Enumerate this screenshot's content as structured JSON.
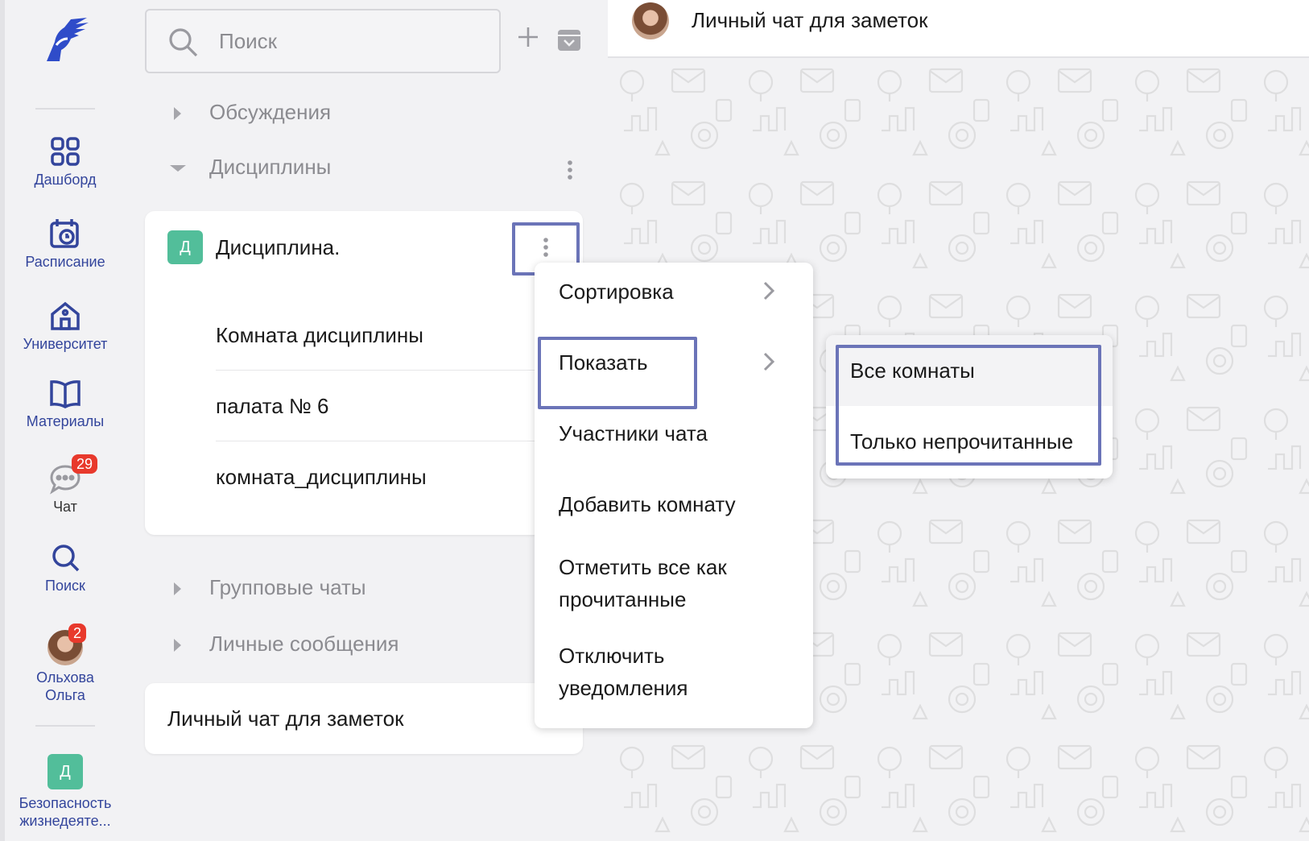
{
  "nav": {
    "items": [
      {
        "label": "Дашборд",
        "icon": "grid-icon"
      },
      {
        "label": "Расписание",
        "icon": "calendar-clock-icon"
      },
      {
        "label": "Университет",
        "icon": "university-icon"
      },
      {
        "label": "Материалы",
        "icon": "book-icon"
      },
      {
        "label": "Чат",
        "icon": "chat-bubble-icon",
        "badge": "29"
      },
      {
        "label": "Поиск",
        "icon": "search-icon"
      }
    ],
    "user": {
      "name_line1": "Ольхова",
      "name_line2": "Ольга",
      "badge": "2"
    },
    "org": {
      "tile": "Д",
      "label_line1": "Безопасность",
      "label_line2": "жизнедеяте..."
    }
  },
  "search": {
    "placeholder": "Поиск"
  },
  "sections": {
    "discussions": "Обсуждения",
    "disciplines": "Дисциплины",
    "group_chats": "Групповые чаты",
    "personal": "Личные сообщения"
  },
  "discipline": {
    "tile": "Д",
    "name": "Дисциплина.",
    "rooms": [
      "Комната дисциплины",
      "палата № 6",
      "комната_дисциплины"
    ]
  },
  "note_chat": "Личный чат для заметок",
  "chat": {
    "title": "Личный чат для заметок"
  },
  "menu": {
    "sort": "Сортировка",
    "show": "Показать",
    "members": "Участники чата",
    "add_room": "Добавить комнату",
    "mark_read_l1": "Отметить все как",
    "mark_read_l2": "прочитанные",
    "mute_l1": "Отключить",
    "mute_l2": "уведомления"
  },
  "submenu": {
    "all_rooms": "Все комнаты",
    "unread_only": "Только непрочитанные"
  },
  "colors": {
    "accent": "#33459c",
    "highlight": "#6b74b8",
    "tile": "#52be9a",
    "badge": "#e8392c"
  }
}
